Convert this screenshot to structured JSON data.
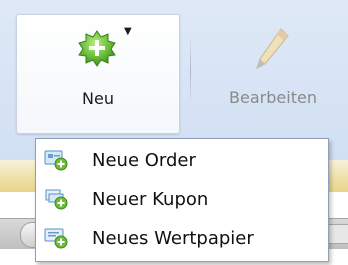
{
  "ribbon": {
    "buttons": [
      {
        "label": "Neu",
        "icon": "add-star-icon",
        "state": "pressed"
      },
      {
        "label": "Bearbeiten",
        "icon": "pencil-icon",
        "state": "disabled"
      }
    ]
  },
  "menu": {
    "items": [
      {
        "label": "Neue Order",
        "icon": "new-order-icon"
      },
      {
        "label": "Neuer Kupon",
        "icon": "new-coupon-icon"
      },
      {
        "label": "Neues Wertpapier",
        "icon": "new-security-icon"
      }
    ]
  },
  "colors": {
    "accent_green": "#66b53a",
    "menu_border": "#8e9fb7",
    "ribbon_bg": "#d6e3f5"
  }
}
